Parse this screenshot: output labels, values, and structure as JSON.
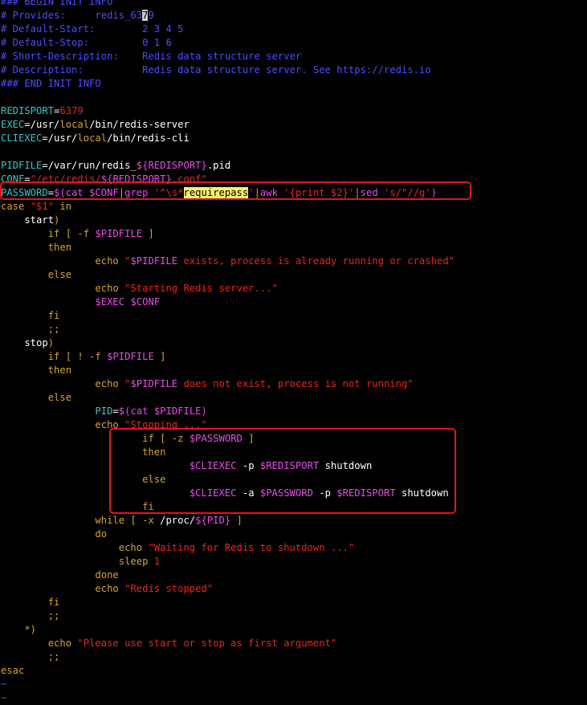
{
  "colors": {
    "background": "#000000",
    "comment": "#4d4dff",
    "variable": "#35c6c6",
    "text": "#ffffff",
    "string": "#e6271e",
    "keyword": "#d4a628",
    "shell_var": "#e84ce8",
    "highlight_box": "#e5141a"
  },
  "editor": {
    "lines": [
      [
        {
          "t": "### BEGIN INIT INFO",
          "c": "comment"
        }
      ],
      [
        {
          "t": "# Provides:     redis_63",
          "c": "comment"
        },
        {
          "t": "7",
          "c": "comment",
          "hl": "cursor"
        },
        {
          "t": "9",
          "c": "comment"
        }
      ],
      [
        {
          "t": "# Default-Start:        2 3 4 5",
          "c": "comment"
        }
      ],
      [
        {
          "t": "# Default-Stop:         0 1 6",
          "c": "comment"
        }
      ],
      [
        {
          "t": "# Short-Description:    Redis data structure server",
          "c": "comment"
        }
      ],
      [
        {
          "t": "# Description:          Redis data structure server. See https://redis.io",
          "c": "comment"
        }
      ],
      [
        {
          "t": "### END INIT INFO",
          "c": "comment"
        }
      ],
      [
        {
          "t": "",
          "c": "text"
        }
      ],
      [
        {
          "t": "REDISPORT",
          "c": "variable"
        },
        {
          "t": "=",
          "c": "text"
        },
        {
          "t": "6379",
          "c": "string"
        }
      ],
      [
        {
          "t": "EXEC",
          "c": "variable"
        },
        {
          "t": "=/usr/",
          "c": "text"
        },
        {
          "t": "local",
          "c": "keyword"
        },
        {
          "t": "/bin/redis-server",
          "c": "text"
        }
      ],
      [
        {
          "t": "CLIEXEC",
          "c": "variable"
        },
        {
          "t": "=/usr/",
          "c": "text"
        },
        {
          "t": "local",
          "c": "keyword"
        },
        {
          "t": "/bin/redis-cli",
          "c": "text"
        }
      ],
      [
        {
          "t": "",
          "c": "text"
        }
      ],
      [
        {
          "t": "PIDFILE",
          "c": "variable"
        },
        {
          "t": "=/var/run/redis_",
          "c": "text"
        },
        {
          "t": "${REDISPORT}",
          "c": "shell_var"
        },
        {
          "t": ".pid",
          "c": "text"
        }
      ],
      [
        {
          "t": "CONF",
          "c": "variable"
        },
        {
          "t": "=",
          "c": "text"
        },
        {
          "t": "\"/etc/redis/",
          "c": "string"
        },
        {
          "t": "${REDISPORT}",
          "c": "shell_var"
        },
        {
          "t": ".conf\"",
          "c": "string"
        }
      ],
      [
        {
          "t": "PASSWORD",
          "c": "variable"
        },
        {
          "t": "=",
          "c": "text"
        },
        {
          "t": "$(",
          "c": "shell_var"
        },
        {
          "t": "cat ",
          "c": "shell_var"
        },
        {
          "t": "$CONF",
          "c": "shell_var"
        },
        {
          "t": "|",
          "c": "keyword"
        },
        {
          "t": "grep ",
          "c": "shell_var"
        },
        {
          "t": "'^\\s*",
          "c": "string"
        },
        {
          "t": "requirepass",
          "c": "string",
          "hl": "selection"
        },
        {
          "t": "'",
          "c": "string"
        },
        {
          "t": "|",
          "c": "keyword"
        },
        {
          "t": "awk ",
          "c": "shell_var"
        },
        {
          "t": "'{print $2}'",
          "c": "string"
        },
        {
          "t": "|",
          "c": "keyword"
        },
        {
          "t": "sed ",
          "c": "shell_var"
        },
        {
          "t": "'s/\"//g'",
          "c": "string"
        },
        {
          "t": ")",
          "c": "shell_var"
        }
      ],
      [
        {
          "t": "case ",
          "c": "keyword"
        },
        {
          "t": "\"$1\"",
          "c": "string"
        },
        {
          "t": " in",
          "c": "keyword"
        }
      ],
      [
        {
          "t": "    start",
          "c": "text"
        },
        {
          "t": ")",
          "c": "keyword"
        }
      ],
      [
        {
          "t": "        ",
          "c": "text"
        },
        {
          "t": "if",
          "c": "keyword"
        },
        {
          "t": " [ ",
          "c": "keyword"
        },
        {
          "t": "-f ",
          "c": "keyword"
        },
        {
          "t": "$PIDFILE",
          "c": "shell_var"
        },
        {
          "t": " ]",
          "c": "keyword"
        }
      ],
      [
        {
          "t": "        then",
          "c": "keyword"
        }
      ],
      [
        {
          "t": "                ",
          "c": "text"
        },
        {
          "t": "echo ",
          "c": "keyword"
        },
        {
          "t": "\"",
          "c": "string"
        },
        {
          "t": "$PIDFILE",
          "c": "shell_var"
        },
        {
          "t": " exists, process is already running or crashed\"",
          "c": "string"
        }
      ],
      [
        {
          "t": "        else",
          "c": "keyword"
        }
      ],
      [
        {
          "t": "                ",
          "c": "text"
        },
        {
          "t": "echo ",
          "c": "keyword"
        },
        {
          "t": "\"Starting Redis server...\"",
          "c": "string"
        }
      ],
      [
        {
          "t": "                ",
          "c": "text"
        },
        {
          "t": "$EXEC",
          "c": "shell_var"
        },
        {
          "t": " ",
          "c": "text"
        },
        {
          "t": "$CONF",
          "c": "shell_var"
        }
      ],
      [
        {
          "t": "        fi",
          "c": "keyword"
        }
      ],
      [
        {
          "t": "        ;;",
          "c": "keyword"
        }
      ],
      [
        {
          "t": "    stop",
          "c": "text"
        },
        {
          "t": ")",
          "c": "keyword"
        }
      ],
      [
        {
          "t": "        ",
          "c": "text"
        },
        {
          "t": "if",
          "c": "keyword"
        },
        {
          "t": " [ ! ",
          "c": "keyword"
        },
        {
          "t": "-f ",
          "c": "keyword"
        },
        {
          "t": "$PIDFILE",
          "c": "shell_var"
        },
        {
          "t": " ]",
          "c": "keyword"
        }
      ],
      [
        {
          "t": "        then",
          "c": "keyword"
        }
      ],
      [
        {
          "t": "                ",
          "c": "text"
        },
        {
          "t": "echo ",
          "c": "keyword"
        },
        {
          "t": "\"",
          "c": "string"
        },
        {
          "t": "$PIDFILE",
          "c": "shell_var"
        },
        {
          "t": " does not exist, process is not running\"",
          "c": "string"
        }
      ],
      [
        {
          "t": "        else",
          "c": "keyword"
        }
      ],
      [
        {
          "t": "                ",
          "c": "text"
        },
        {
          "t": "PID",
          "c": "variable"
        },
        {
          "t": "=",
          "c": "text"
        },
        {
          "t": "$(",
          "c": "shell_var"
        },
        {
          "t": "cat ",
          "c": "shell_var"
        },
        {
          "t": "$PIDFILE",
          "c": "shell_var"
        },
        {
          "t": ")",
          "c": "shell_var"
        }
      ],
      [
        {
          "t": "                ",
          "c": "text"
        },
        {
          "t": "echo ",
          "c": "keyword"
        },
        {
          "t": "\"Stopping ...\"",
          "c": "string"
        }
      ],
      [
        {
          "t": "                        ",
          "c": "text"
        },
        {
          "t": "if",
          "c": "keyword"
        },
        {
          "t": " [ ",
          "c": "keyword"
        },
        {
          "t": "-z ",
          "c": "keyword"
        },
        {
          "t": "$PASSWORD",
          "c": "shell_var"
        },
        {
          "t": " ]",
          "c": "keyword"
        }
      ],
      [
        {
          "t": "                        then",
          "c": "keyword"
        }
      ],
      [
        {
          "t": "                                ",
          "c": "text"
        },
        {
          "t": "$CLIEXEC",
          "c": "shell_var"
        },
        {
          "t": " -p ",
          "c": "text"
        },
        {
          "t": "$REDISPORT",
          "c": "shell_var"
        },
        {
          "t": " shutdown",
          "c": "text"
        }
      ],
      [
        {
          "t": "                        else",
          "c": "keyword"
        }
      ],
      [
        {
          "t": "                                ",
          "c": "text"
        },
        {
          "t": "$CLIEXEC",
          "c": "shell_var"
        },
        {
          "t": " -a ",
          "c": "text"
        },
        {
          "t": "$PASSWORD",
          "c": "shell_var"
        },
        {
          "t": " -p ",
          "c": "text"
        },
        {
          "t": "$REDISPORT",
          "c": "shell_var"
        },
        {
          "t": " shutdown",
          "c": "text"
        }
      ],
      [
        {
          "t": "                        fi",
          "c": "keyword"
        }
      ],
      [
        {
          "t": "                ",
          "c": "text"
        },
        {
          "t": "while",
          "c": "keyword"
        },
        {
          "t": " [ ",
          "c": "keyword"
        },
        {
          "t": "-x ",
          "c": "keyword"
        },
        {
          "t": "/proc/",
          "c": "text"
        },
        {
          "t": "${PID}",
          "c": "shell_var"
        },
        {
          "t": " ]",
          "c": "keyword"
        }
      ],
      [
        {
          "t": "                do",
          "c": "keyword"
        }
      ],
      [
        {
          "t": "                    ",
          "c": "text"
        },
        {
          "t": "echo ",
          "c": "keyword"
        },
        {
          "t": "\"Waiting for Redis to shutdown ...\"",
          "c": "string"
        }
      ],
      [
        {
          "t": "                    ",
          "c": "text"
        },
        {
          "t": "sleep ",
          "c": "keyword"
        },
        {
          "t": "1",
          "c": "string"
        }
      ],
      [
        {
          "t": "                done",
          "c": "keyword"
        }
      ],
      [
        {
          "t": "                ",
          "c": "text"
        },
        {
          "t": "echo ",
          "c": "keyword"
        },
        {
          "t": "\"Redis stopped\"",
          "c": "string"
        }
      ],
      [
        {
          "t": "        fi",
          "c": "keyword"
        }
      ],
      [
        {
          "t": "        ;;",
          "c": "keyword"
        }
      ],
      [
        {
          "t": "    *)",
          "c": "keyword"
        }
      ],
      [
        {
          "t": "        ",
          "c": "text"
        },
        {
          "t": "echo ",
          "c": "keyword"
        },
        {
          "t": "\"Please use start or stop as first argument\"",
          "c": "string"
        }
      ],
      [
        {
          "t": "        ;;",
          "c": "keyword"
        }
      ],
      [
        {
          "t": "esac",
          "c": "keyword"
        }
      ],
      [
        {
          "t": "~",
          "c": "comment"
        }
      ],
      [
        {
          "t": "~",
          "c": "comment"
        }
      ]
    ]
  }
}
